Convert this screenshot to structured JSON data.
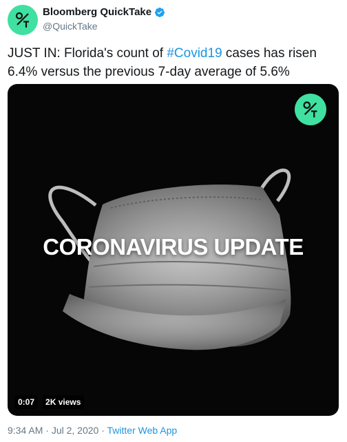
{
  "account": {
    "display_name": "Bloomberg QuickTake",
    "handle": "@QuickTake",
    "verified": true,
    "brand_color": "#3fe0a0"
  },
  "tweet": {
    "text_before_hashtag": "JUST IN: Florida's count of ",
    "hashtag": "#Covid19",
    "text_after_hashtag": " cases has risen 6.4% versus the previous 7-day average of 5.6%"
  },
  "media": {
    "overlay_title": "CORONAVIRUS UPDATE",
    "duration": "0:07",
    "views": "2K views"
  },
  "footer": {
    "time": "9:34 AM",
    "date": "Jul 2, 2020",
    "separator": "·",
    "source_app": "Twitter Web App"
  },
  "colors": {
    "link": "#1b95e0",
    "muted": "#657786",
    "verified_badge": "#1da1f2"
  },
  "icons": {
    "avatar": "quicktake-logo-icon",
    "verified": "verified-badge-icon",
    "media_logo": "quicktake-logo-icon"
  }
}
